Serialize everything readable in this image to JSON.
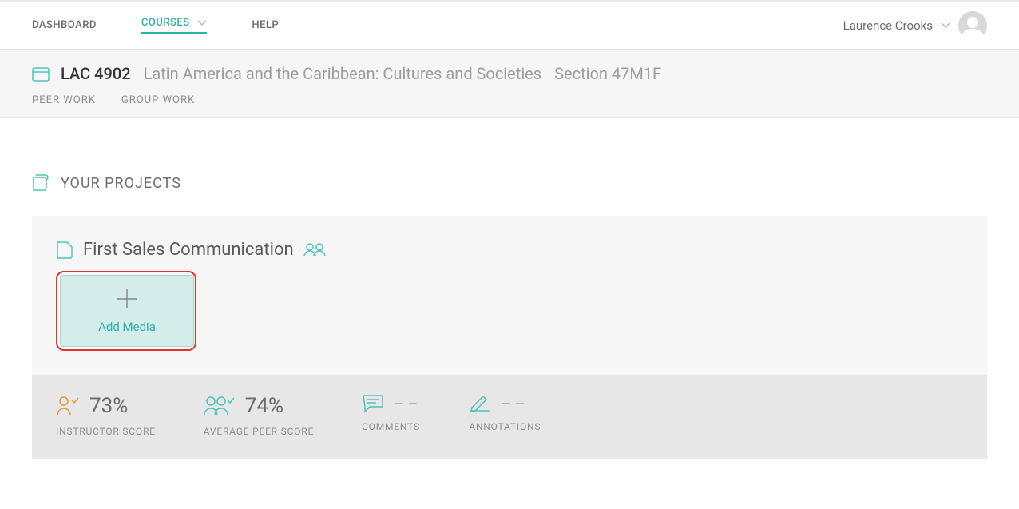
{
  "topnav": {
    "dashboard": "DASHBOARD",
    "courses": "COURSES",
    "help": "HELP"
  },
  "user": {
    "name": "Laurence Crooks"
  },
  "course": {
    "code": "LAC 4902",
    "title": "Latin America and the Caribbean: Cultures and Societies",
    "section": "Section 47M1F"
  },
  "subtabs": {
    "peer_work": "PEER WORK",
    "group_work": "GROUP WORK"
  },
  "section_title": "YOUR PROJECTS",
  "project": {
    "title": "First Sales Communication",
    "add_media_label": "Add Media"
  },
  "stats": {
    "instructor_score": {
      "value": "73%",
      "label": "INSTRUCTOR SCORE"
    },
    "avg_peer_score": {
      "value": "74%",
      "label": "AVERAGE PEER SCORE"
    },
    "comments": {
      "value": "––",
      "label": "COMMENTS"
    },
    "annotations": {
      "value": "––",
      "label": "ANNOTATIONS"
    }
  }
}
